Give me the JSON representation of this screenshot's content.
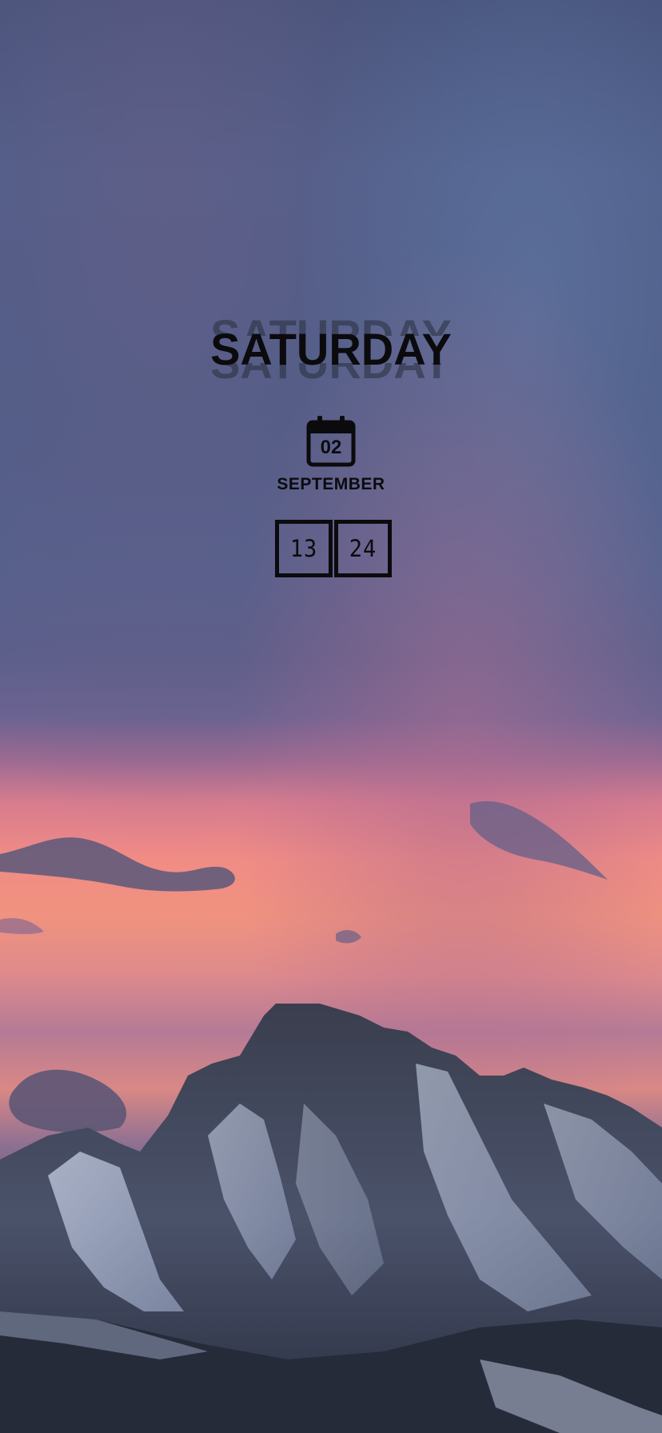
{
  "lockscreen": {
    "day_name": "SATURDAY",
    "date": {
      "day": "02",
      "month": "SEPTEMBER",
      "icon": "calendar-icon"
    },
    "time": {
      "hour": "13",
      "minute": "24"
    }
  },
  "colors": {
    "text": "#0b0b0e",
    "ghost_text": "#2d3444",
    "sky_top": "#4a5b86",
    "sunset": "#f08a80"
  }
}
